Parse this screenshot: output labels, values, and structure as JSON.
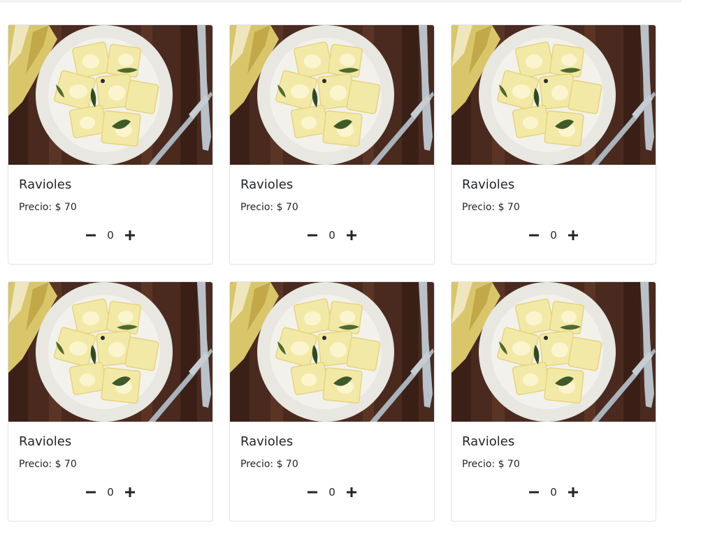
{
  "products": [
    {
      "name": "Ravioles",
      "price": "Precio: $ 70",
      "quantity": "0"
    },
    {
      "name": "Ravioles",
      "price": "Precio: $ 70",
      "quantity": "0"
    },
    {
      "name": "Ravioles",
      "price": "Precio: $ 70",
      "quantity": "0"
    },
    {
      "name": "Ravioles",
      "price": "Precio: $ 70",
      "quantity": "0"
    },
    {
      "name": "Ravioles",
      "price": "Precio: $ 70",
      "quantity": "0"
    },
    {
      "name": "Ravioles",
      "price": "Precio: $ 70",
      "quantity": "0"
    }
  ],
  "icons": {
    "decrement": "minus-icon",
    "increment": "plus-icon"
  },
  "colors": {
    "text": "#212529",
    "border": "#dee2e6",
    "table_wood": "#4a2a1f",
    "plate": "#eeeeea",
    "pasta": "#f3e9a6"
  }
}
